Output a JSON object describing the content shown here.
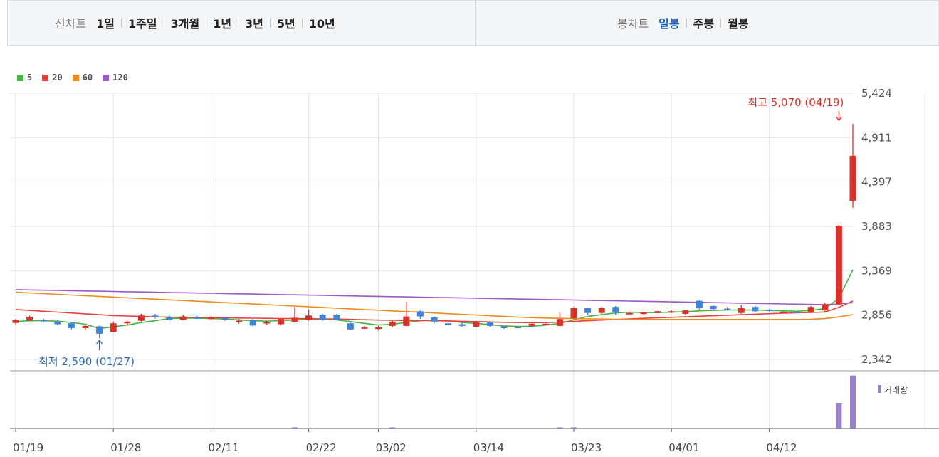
{
  "line_chart": {
    "label": "선차트",
    "options": [
      "1일",
      "1주일",
      "3개월",
      "1년",
      "3년",
      "5년",
      "10년"
    ]
  },
  "candle_chart": {
    "label": "봉차트",
    "options": [
      "일봉",
      "주봉",
      "월봉"
    ],
    "active": "일봉"
  },
  "legend": [
    {
      "name": "5",
      "color": "#44b544"
    },
    {
      "name": "20",
      "color": "#e8423c"
    },
    {
      "name": "60",
      "color": "#f18a1c"
    },
    {
      "name": "120",
      "color": "#9c58c6"
    }
  ],
  "volume_label": "거래량",
  "chart_data": {
    "type": "candlestick",
    "y_ticks": [
      5424,
      4911,
      4397,
      3883,
      3369,
      2856,
      2342
    ],
    "y_tick_labels": [
      "5,424",
      "4,911",
      "4,397",
      "3,883",
      "3,369",
      "2,856",
      "2,342"
    ],
    "ylim": [
      2342,
      5424
    ],
    "x_tick_labels": [
      "01/19",
      "01/28",
      "02/11",
      "02/22",
      "03/02",
      "03/14",
      "03/23",
      "04/01",
      "04/12"
    ],
    "x_tick_index": [
      0,
      7,
      14,
      21,
      26,
      33,
      40,
      47,
      54
    ],
    "grid": true,
    "high_annotation": "최고 5,070 (04/19)",
    "low_annotation": "최저 2,590 (01/27)",
    "high_index": 59,
    "low_index": 6,
    "candles": [
      [
        2765,
        2810,
        2750,
        2800
      ],
      [
        2790,
        2850,
        2785,
        2835
      ],
      [
        2800,
        2815,
        2775,
        2785
      ],
      [
        2780,
        2795,
        2740,
        2750
      ],
      [
        2760,
        2775,
        2690,
        2705
      ],
      [
        2705,
        2740,
        2690,
        2730
      ],
      [
        2725,
        2735,
        2590,
        2640
      ],
      [
        2660,
        2780,
        2655,
        2760
      ],
      [
        2760,
        2790,
        2745,
        2780
      ],
      [
        2790,
        2870,
        2780,
        2850
      ],
      [
        2850,
        2870,
        2815,
        2830
      ],
      [
        2830,
        2850,
        2780,
        2800
      ],
      [
        2800,
        2860,
        2795,
        2840
      ],
      [
        2830,
        2845,
        2810,
        2820
      ],
      [
        2810,
        2845,
        2795,
        2830
      ],
      [
        2820,
        2830,
        2790,
        2800
      ],
      [
        2780,
        2810,
        2755,
        2790
      ],
      [
        2800,
        2810,
        2725,
        2735
      ],
      [
        2760,
        2790,
        2745,
        2775
      ],
      [
        2750,
        2820,
        2740,
        2810
      ],
      [
        2780,
        2950,
        2770,
        2825
      ],
      [
        2800,
        2920,
        2790,
        2850
      ],
      [
        2860,
        2870,
        2790,
        2800
      ],
      [
        2860,
        2870,
        2800,
        2800
      ],
      [
        2760,
        2770,
        2680,
        2690
      ],
      [
        2710,
        2730,
        2695,
        2715
      ],
      [
        2695,
        2730,
        2675,
        2715
      ],
      [
        2730,
        2790,
        2720,
        2780
      ],
      [
        2730,
        3010,
        2725,
        2840
      ],
      [
        2900,
        2910,
        2810,
        2840
      ],
      [
        2830,
        2840,
        2760,
        2780
      ],
      [
        2760,
        2775,
        2735,
        2745
      ],
      [
        2750,
        2765,
        2720,
        2730
      ],
      [
        2720,
        2790,
        2715,
        2780
      ],
      [
        2770,
        2775,
        2720,
        2730
      ],
      [
        2725,
        2730,
        2695,
        2705
      ],
      [
        2720,
        2725,
        2710,
        2715
      ],
      [
        2730,
        2760,
        2720,
        2755
      ],
      [
        2740,
        2760,
        2735,
        2755
      ],
      [
        2730,
        2890,
        2725,
        2810
      ],
      [
        2820,
        2950,
        2810,
        2940
      ],
      [
        2940,
        2945,
        2860,
        2880
      ],
      [
        2880,
        2950,
        2870,
        2940
      ],
      [
        2950,
        2960,
        2860,
        2890
      ],
      [
        2880,
        2895,
        2865,
        2880
      ],
      [
        2870,
        2890,
        2860,
        2885
      ],
      [
        2880,
        2905,
        2875,
        2900
      ],
      [
        2890,
        2910,
        2880,
        2900
      ],
      [
        2870,
        2920,
        2860,
        2910
      ],
      [
        3020,
        3025,
        2920,
        2935
      ],
      [
        2960,
        2970,
        2910,
        2925
      ],
      [
        2930,
        2950,
        2910,
        2920
      ],
      [
        2880,
        2970,
        2870,
        2940
      ],
      [
        2950,
        2960,
        2890,
        2900
      ],
      [
        2920,
        2925,
        2895,
        2910
      ],
      [
        2890,
        2900,
        2880,
        2895
      ],
      [
        2895,
        2900,
        2885,
        2890
      ],
      [
        2890,
        2960,
        2880,
        2950
      ],
      [
        2910,
        3000,
        2895,
        2980
      ],
      [
        2980,
        3900,
        2975,
        3890
      ],
      [
        4180,
        5070,
        4100,
        4700
      ]
    ],
    "volume": [
      0,
      0,
      0,
      0,
      0,
      0,
      0,
      0,
      0,
      0,
      0,
      0,
      0,
      0,
      0,
      0,
      0,
      0,
      0,
      0,
      0.02,
      0,
      0,
      0,
      0,
      0,
      0,
      0.02,
      0,
      0,
      0,
      0,
      0,
      0,
      0,
      0,
      0,
      0,
      0,
      0.02,
      0.02,
      0,
      0,
      0,
      0,
      0,
      0,
      0,
      0,
      0,
      0,
      0,
      0,
      0,
      0,
      0,
      0,
      0,
      0,
      0.45,
      0.93
    ],
    "series": [
      {
        "name": "5",
        "values": [
          2780,
          2790,
          2790,
          2785,
          2770,
          2750,
          2700,
          2720,
          2740,
          2770,
          2790,
          2815,
          2820,
          2820,
          2815,
          2810,
          2800,
          2790,
          2785,
          2790,
          2800,
          2810,
          2810,
          2800,
          2780,
          2760,
          2740,
          2750,
          2770,
          2790,
          2800,
          2790,
          2770,
          2760,
          2745,
          2730,
          2725,
          2725,
          2740,
          2760,
          2800,
          2840,
          2860,
          2880,
          2890,
          2885,
          2885,
          2890,
          2895,
          2905,
          2910,
          2915,
          2915,
          2915,
          2910,
          2905,
          2900,
          2910,
          2930,
          3050,
          3380
        ]
      },
      {
        "name": "20",
        "values": [
          2920,
          2910,
          2900,
          2890,
          2880,
          2870,
          2860,
          2850,
          2845,
          2840,
          2835,
          2832,
          2830,
          2828,
          2826,
          2824,
          2822,
          2820,
          2818,
          2816,
          2815,
          2814,
          2812,
          2810,
          2806,
          2802,
          2798,
          2795,
          2793,
          2792,
          2790,
          2788,
          2784,
          2780,
          2776,
          2772,
          2770,
          2768,
          2770,
          2775,
          2782,
          2790,
          2798,
          2805,
          2812,
          2818,
          2824,
          2830,
          2836,
          2842,
          2848,
          2854,
          2860,
          2866,
          2872,
          2878,
          2882,
          2886,
          2892,
          2945,
          3020
        ]
      },
      {
        "name": "60",
        "values": [
          3120,
          3112,
          3104,
          3096,
          3088,
          3080,
          3072,
          3064,
          3056,
          3048,
          3040,
          3032,
          3024,
          3016,
          3008,
          3000,
          2992,
          2984,
          2976,
          2968,
          2960,
          2952,
          2944,
          2936,
          2928,
          2920,
          2912,
          2904,
          2896,
          2888,
          2880,
          2872,
          2864,
          2856,
          2848,
          2840,
          2832,
          2826,
          2822,
          2818,
          2815,
          2812,
          2810,
          2808,
          2806,
          2805,
          2805,
          2805,
          2805,
          2805,
          2805,
          2805,
          2805,
          2805,
          2805,
          2805,
          2805,
          2808,
          2815,
          2835,
          2860
        ]
      },
      {
        "name": "120",
        "values": [
          3150,
          3147,
          3144,
          3141,
          3138,
          3135,
          3132,
          3129,
          3126,
          3123,
          3120,
          3117,
          3114,
          3111,
          3108,
          3105,
          3102,
          3099,
          3096,
          3093,
          3090,
          3087,
          3084,
          3081,
          3078,
          3075,
          3072,
          3069,
          3066,
          3063,
          3060,
          3057,
          3054,
          3051,
          3048,
          3045,
          3042,
          3039,
          3036,
          3033,
          3030,
          3027,
          3024,
          3021,
          3018,
          3015,
          3012,
          3009,
          3006,
          3003,
          3000,
          2997,
          2994,
          2991,
          2988,
          2985,
          2982,
          2979,
          2976,
          2985,
          3000
        ]
      }
    ]
  }
}
